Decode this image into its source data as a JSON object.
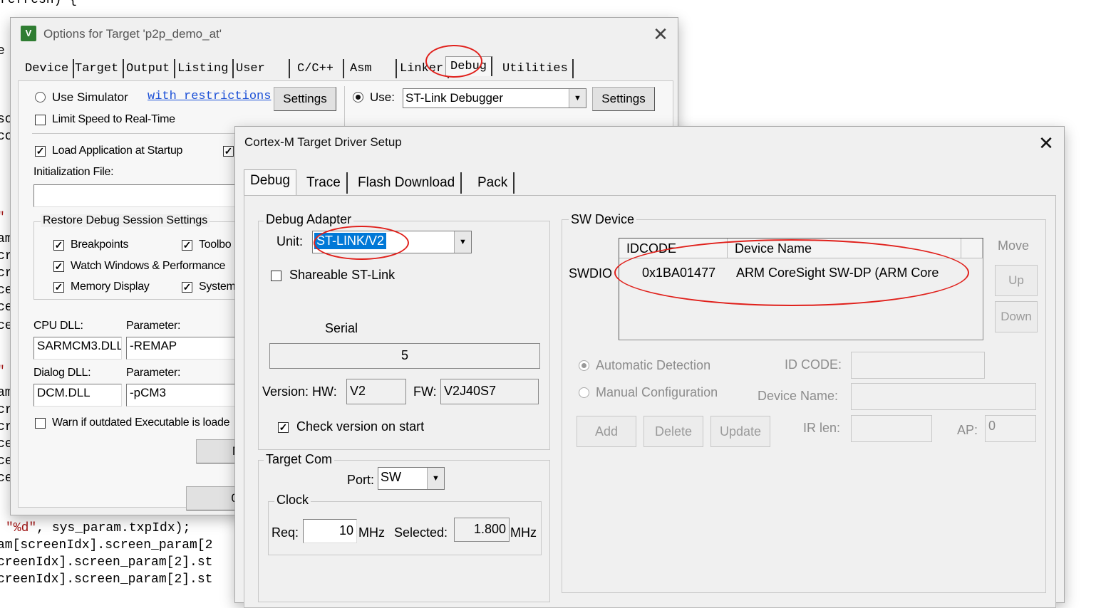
{
  "background_code": {
    "top": "refresh) {",
    "bottom_lines": [
      {
        "pre": "",
        "str": "\"%d\"",
        "post": ", sys_param.txpIdx);"
      },
      {
        "pre": "am[screenIdx].screen_param[2",
        "str": "",
        "post": ""
      },
      {
        "pre": "creenIdx].screen_param[2].st",
        "str": "",
        "post": ""
      },
      {
        "pre": "creenIdx].screen_param[2].st",
        "str": "",
        "post": ""
      }
    ],
    "left_chars": [
      "e",
      "sc",
      "cc",
      "\"",
      "am",
      "cr",
      "cr",
      "ce",
      "ce",
      "ce",
      "\"",
      "am",
      "cr",
      "cr",
      "ce",
      "ce",
      "ce"
    ]
  },
  "options_window": {
    "title": "Options for Target 'p2p_demo_at'",
    "tabs": [
      "Device",
      "Target",
      "Output",
      "Listing",
      "User",
      "C/C++",
      "Asm",
      "Linker",
      "Debug",
      "Utilities"
    ],
    "use_simulator": "Use Simulator",
    "with_restrictions": "with restrictions",
    "settings": "Settings",
    "limit_speed": "Limit Speed to Real-Time",
    "use": "Use:",
    "debugger": "ST-Link Debugger",
    "load_app": "Load Application at Startup",
    "init_file": "Initialization File:",
    "restore_session": "Restore Debug Session Settings",
    "breakpoints": "Breakpoints",
    "toolbox": "Toolbo",
    "watch_windows": "Watch Windows & Performance",
    "memory_display": "Memory Display",
    "system": "System",
    "cpu_dll": "CPU DLL:",
    "parameter": "Parameter:",
    "cpu_dll_value": "SARMCM3.DLL",
    "cpu_param_value": "-REMAP",
    "dialog_dll": "Dialog DLL:",
    "dialog_dll_value": "DCM.DLL",
    "dialog_param_value": "-pCM3",
    "warn_outdated": "Warn if outdated Executable is loade",
    "manage_btn": "M",
    "ok_btn": "0"
  },
  "driver_window": {
    "title": "Cortex-M Target Driver Setup",
    "tabs": [
      "Debug",
      "Trace",
      "Flash Download",
      "Pack"
    ],
    "debug_adapter": {
      "title": "Debug Adapter",
      "unit_label": "Unit:",
      "unit_value": "ST-LINK/V2",
      "shareable": "Shareable ST-Link",
      "serial_label": "Serial",
      "serial_value": "5",
      "version_hw_label": "Version: HW:",
      "hw_value": "V2",
      "fw_label": "FW:",
      "fw_value": "V2J40S7",
      "check_version": "Check version on start"
    },
    "target_com": {
      "title": "Target Com",
      "port_label": "Port:",
      "port_value": "SW",
      "clock_title": "Clock",
      "req_label": "Req:",
      "req_value": "10",
      "mhz": "MHz",
      "selected_label": "Selected:",
      "selected_value": "1.800"
    },
    "sw_device": {
      "title": "SW Device",
      "col_idcode": "IDCODE",
      "col_device_name": "Device Name",
      "row_label": "SWDIO",
      "row_idcode": "0x1BA01477",
      "row_device_name": "ARM CoreSight SW-DP (ARM Core",
      "move": "Move",
      "up": "Up",
      "down": "Down",
      "auto_detect": "Automatic Detection",
      "manual_config": "Manual Configuration",
      "id_code_label": "ID CODE:",
      "device_name_label": "Device Name:",
      "add": "Add",
      "delete": "Delete",
      "update": "Update",
      "ir_len_label": "IR len:",
      "ap_label": "AP:",
      "ap_value": "0"
    }
  },
  "colors": {
    "annotation": "#e0201b",
    "selection": "#0078d7",
    "link": "#1a4fd6"
  }
}
